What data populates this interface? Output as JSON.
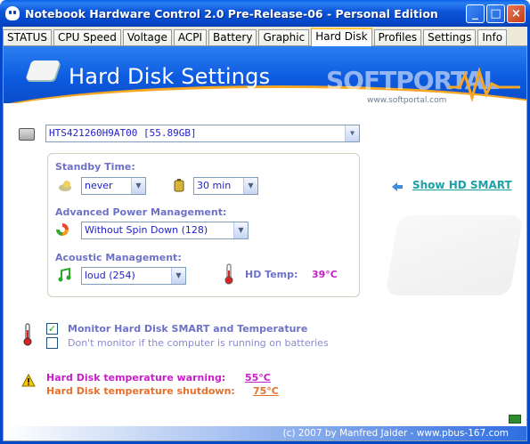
{
  "window": {
    "title": "Notebook Hardware Control 2.0 Pre-Release-06  -  Personal Edition",
    "minimize_glyph": "_",
    "maximize_glyph": "□",
    "close_glyph": "×"
  },
  "tabs": [
    {
      "label": "STATUS"
    },
    {
      "label": "CPU Speed"
    },
    {
      "label": "Voltage"
    },
    {
      "label": "ACPI"
    },
    {
      "label": "Battery"
    },
    {
      "label": "Graphic"
    },
    {
      "label": "Hard Disk",
      "active": true
    },
    {
      "label": "Profiles"
    },
    {
      "label": "Settings"
    },
    {
      "label": "Info"
    }
  ],
  "banner": {
    "title": "Hard Disk Settings",
    "watermark": "SOFTPORTAL",
    "watermark_sub": "www.softportal.com"
  },
  "disk": {
    "selected": "HTS421260H9AT00  [55.89GB]"
  },
  "standby": {
    "label": "Standby Time:",
    "left_value": "never",
    "right_value": "30 min"
  },
  "apm": {
    "label": "Advanced Power Management:",
    "value": "Without Spin Down (128)"
  },
  "acoustic": {
    "label": "Acoustic Management:",
    "value": "loud (254)"
  },
  "hd_temp": {
    "label": "HD Temp:",
    "value": "39°C"
  },
  "smart_link": "Show HD SMART",
  "monitor": {
    "checked_label": "Monitor Hard Disk SMART and Temperature",
    "unchecked_label": "Don't monitor if the computer is running on batteries",
    "checked": true,
    "battery_checked": false,
    "check_glyph": "✓"
  },
  "temperature": {
    "warning_label": "Hard Disk temperature warning:",
    "warning_value": "55°C",
    "shutdown_label": "Hard Disk temperature shutdown:",
    "shutdown_value": "75°C"
  },
  "footer": "(c) 2007 by Manfred Jaider - www.pbus-167.com",
  "colors": {
    "label": "#6e72c6",
    "value": "#1f1fd0",
    "warning": "#c81ec8",
    "shutdown": "#e8702a",
    "link": "#1aa0a6",
    "temp": "#c81ec8"
  }
}
